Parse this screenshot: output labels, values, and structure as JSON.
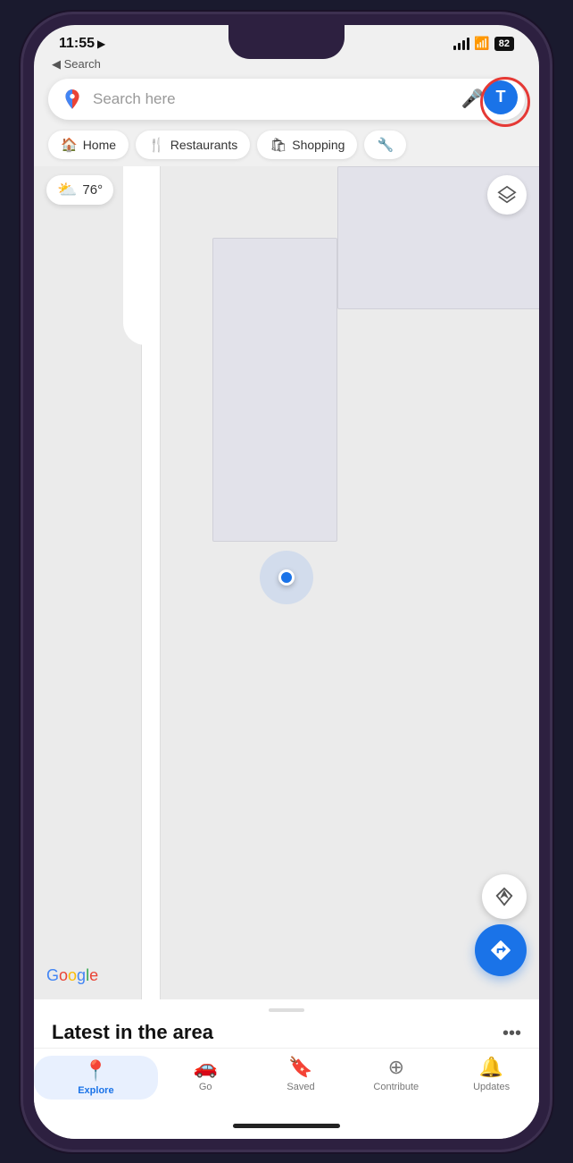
{
  "status": {
    "time": "11:55",
    "arrow": "▶",
    "back": "◀ Search",
    "battery": "82"
  },
  "search": {
    "placeholder": "Search here",
    "avatar_letter": "T"
  },
  "categories": [
    {
      "id": "home",
      "icon": "🏠",
      "label": "Home"
    },
    {
      "id": "restaurants",
      "icon": "🍴",
      "label": "Restaurants"
    },
    {
      "id": "shopping",
      "icon": "🛍",
      "label": "Shopping"
    },
    {
      "id": "tools",
      "icon": "🔧",
      "label": ""
    }
  ],
  "weather": {
    "icon": "⛅",
    "temp": "76°"
  },
  "bottom_sheet": {
    "title": "Latest in the area",
    "more_icon": "•••"
  },
  "bottom_nav": [
    {
      "id": "explore",
      "icon": "📍",
      "label": "Explore",
      "active": true
    },
    {
      "id": "go",
      "icon": "🚗",
      "label": "Go",
      "active": false
    },
    {
      "id": "saved",
      "icon": "🔖",
      "label": "Saved",
      "active": false
    },
    {
      "id": "contribute",
      "icon": "➕",
      "label": "Contribute",
      "active": false
    },
    {
      "id": "updates",
      "icon": "🔔",
      "label": "Updates",
      "active": false
    }
  ],
  "google_logo": "Google",
  "map": {
    "location_visible": true
  }
}
